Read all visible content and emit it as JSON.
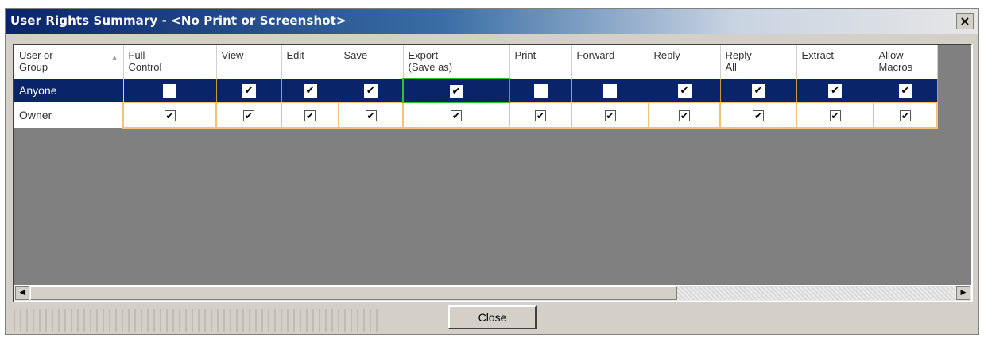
{
  "window": {
    "title": "User Rights Summary - <No Print or Screenshot>",
    "close_glyph": "×"
  },
  "grid": {
    "columns": [
      {
        "label": "User or\nGroup"
      },
      {
        "label": "Full\nControl"
      },
      {
        "label": "View"
      },
      {
        "label": "Edit"
      },
      {
        "label": "Save"
      },
      {
        "label": "Export\n(Save as)"
      },
      {
        "label": "Print"
      },
      {
        "label": "Forward"
      },
      {
        "label": "Reply"
      },
      {
        "label": "Reply\nAll"
      },
      {
        "label": "Extract"
      },
      {
        "label": "Allow\nMacros"
      }
    ],
    "rows": [
      {
        "name": "Anyone",
        "selected": true,
        "rights": [
          false,
          true,
          true,
          true,
          true,
          false,
          false,
          true,
          true,
          true,
          true
        ]
      },
      {
        "name": "Owner",
        "selected": false,
        "rights": [
          true,
          true,
          true,
          true,
          true,
          true,
          true,
          true,
          true,
          true,
          true
        ]
      }
    ]
  },
  "footer": {
    "close_label": "Close"
  },
  "icons": {
    "sort": "sort-indicator-icon",
    "scroll_left": "scroll-left-icon",
    "scroll_right": "scroll-right-icon",
    "check": "checkmark-icon"
  },
  "colors": {
    "selection": "#0a246a",
    "focus": "#30c030",
    "owner_border": "#f0c27a"
  }
}
